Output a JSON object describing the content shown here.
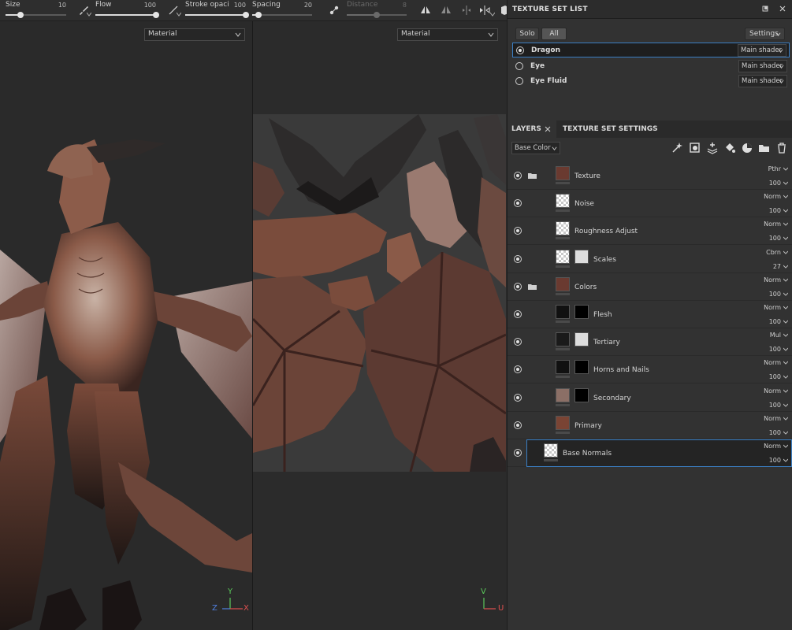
{
  "toolbar": {
    "size": {
      "label": "Size",
      "value": "10",
      "level": 0.25
    },
    "flow": {
      "label": "Flow",
      "value": "100",
      "level": 1.0
    },
    "stroke_opacity": {
      "label": "Stroke opaci",
      "value": "100",
      "level": 1.0
    },
    "spacing": {
      "label": "Spacing",
      "value": "20",
      "level": 0.1
    },
    "distance": {
      "label": "Distance",
      "value": "8",
      "level": 0.5
    }
  },
  "viewport_3d": {
    "mode": "Material",
    "axes": {
      "y": "Y",
      "z": "Z",
      "x": "X"
    }
  },
  "viewport_2d": {
    "mode": "Material",
    "axes": {
      "v": "V",
      "u": "U"
    }
  },
  "texture_set_list": {
    "title": "TEXTURE SET LIST",
    "solo_label": "Solo",
    "all_label": "All",
    "settings_label": "Settings",
    "sets": [
      {
        "name": "Dragon",
        "shader": "Main shader",
        "selected": true
      },
      {
        "name": "Eye",
        "shader": "Main shader",
        "selected": false
      },
      {
        "name": "Eye Fluid",
        "shader": "Main shader",
        "selected": false
      }
    ]
  },
  "tabs": {
    "layers": "LAYERS",
    "texture_set_settings": "TEXTURE SET SETTINGS"
  },
  "channel_select": "Base Color",
  "layers": [
    {
      "name": "Texture",
      "blend": "Pthr",
      "opacity": "100",
      "folder": true
    },
    {
      "name": "Noise",
      "blend": "Norm",
      "opacity": "100"
    },
    {
      "name": "Roughness Adjust",
      "blend": "Norm",
      "opacity": "100"
    },
    {
      "name": "Scales",
      "blend": "Cbrn",
      "opacity": "27"
    },
    {
      "name": "Colors",
      "blend": "Norm",
      "opacity": "100",
      "folder": true
    },
    {
      "name": "Flesh",
      "blend": "Norm",
      "opacity": "100"
    },
    {
      "name": "Tertiary",
      "blend": "Mul",
      "opacity": "100"
    },
    {
      "name": "Horns and Nails",
      "blend": "Norm",
      "opacity": "100"
    },
    {
      "name": "Secondary",
      "blend": "Norm",
      "opacity": "100"
    },
    {
      "name": "Primary",
      "blend": "Norm",
      "opacity": "100"
    },
    {
      "name": "Base Normals",
      "blend": "Norm",
      "opacity": "100",
      "selected": true
    }
  ],
  "colors": {
    "accent": "#3b7fc4",
    "axis_x": "#e05050",
    "axis_y": "#5bc85b",
    "axis_z": "#5080e0"
  }
}
